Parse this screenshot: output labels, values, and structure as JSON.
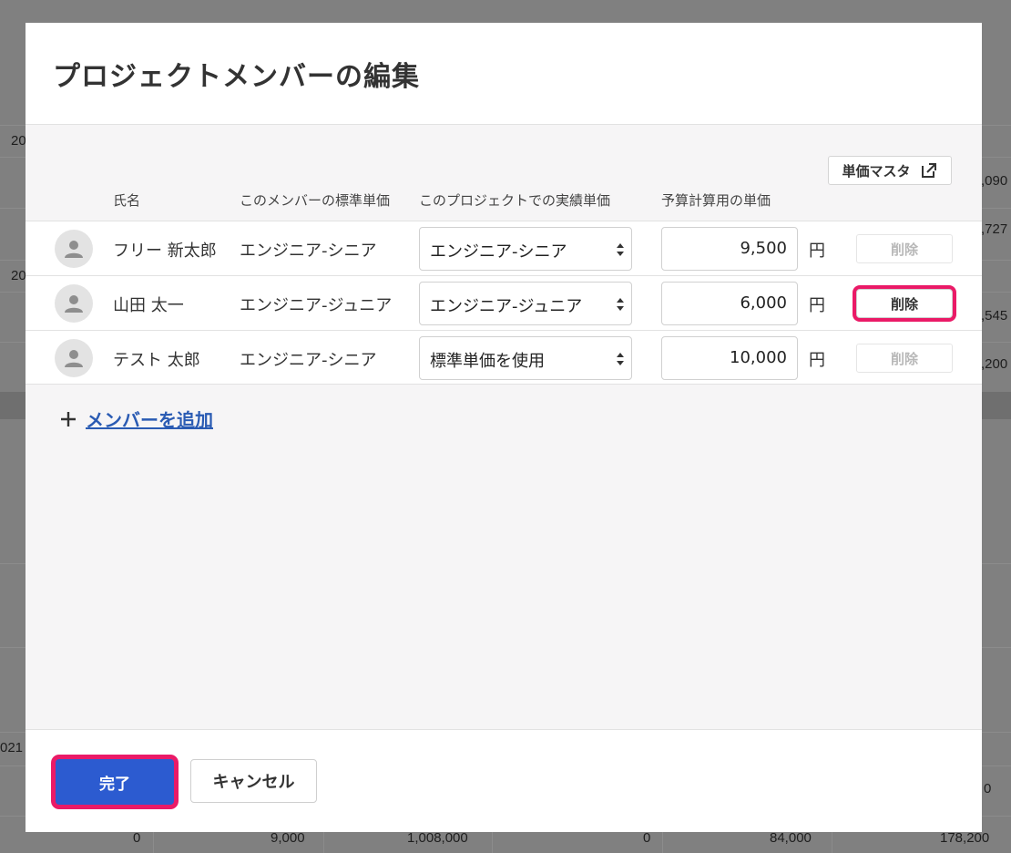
{
  "dialog": {
    "title": "プロジェクトメンバーの編集",
    "master_button_label": "単価マスタ",
    "columns": {
      "name": "氏名",
      "standard_rate": "このメンバーの標準単価",
      "project_rate": "このプロジェクトでの実績単価",
      "budget_rate": "予算計算用の単価"
    },
    "members": [
      {
        "name": "フリー 新太郎",
        "standard_rate": "エンジニア-シニア",
        "project_rate": "エンジニア-シニア",
        "budget_rate": "9,500",
        "unit": "円",
        "delete_label": "削除"
      },
      {
        "name": "山田 太一",
        "standard_rate": "エンジニア-ジュニア",
        "project_rate": "エンジニア-ジュニア",
        "budget_rate": "6,000",
        "unit": "円",
        "delete_label": "削除"
      },
      {
        "name": "テスト 太郎",
        "standard_rate": "エンジニア-シニア",
        "project_rate": "標準単価を使用",
        "budget_rate": "10,000",
        "unit": "円",
        "delete_label": "削除"
      }
    ],
    "add_member_label": "メンバーを追加",
    "done_label": "完了",
    "cancel_label": "キャンセル"
  },
  "background": {
    "fragments": [
      "20",
      ",090",
      ",727",
      "20",
      ",545",
      ",200",
      "021",
      "0",
      "0",
      "9,000",
      "1,008,000",
      "0",
      "84,000",
      "178,200"
    ]
  },
  "colors": {
    "primary": "#2c5bd0",
    "highlight": "#ea1a67",
    "link": "#2a5bb3"
  }
}
